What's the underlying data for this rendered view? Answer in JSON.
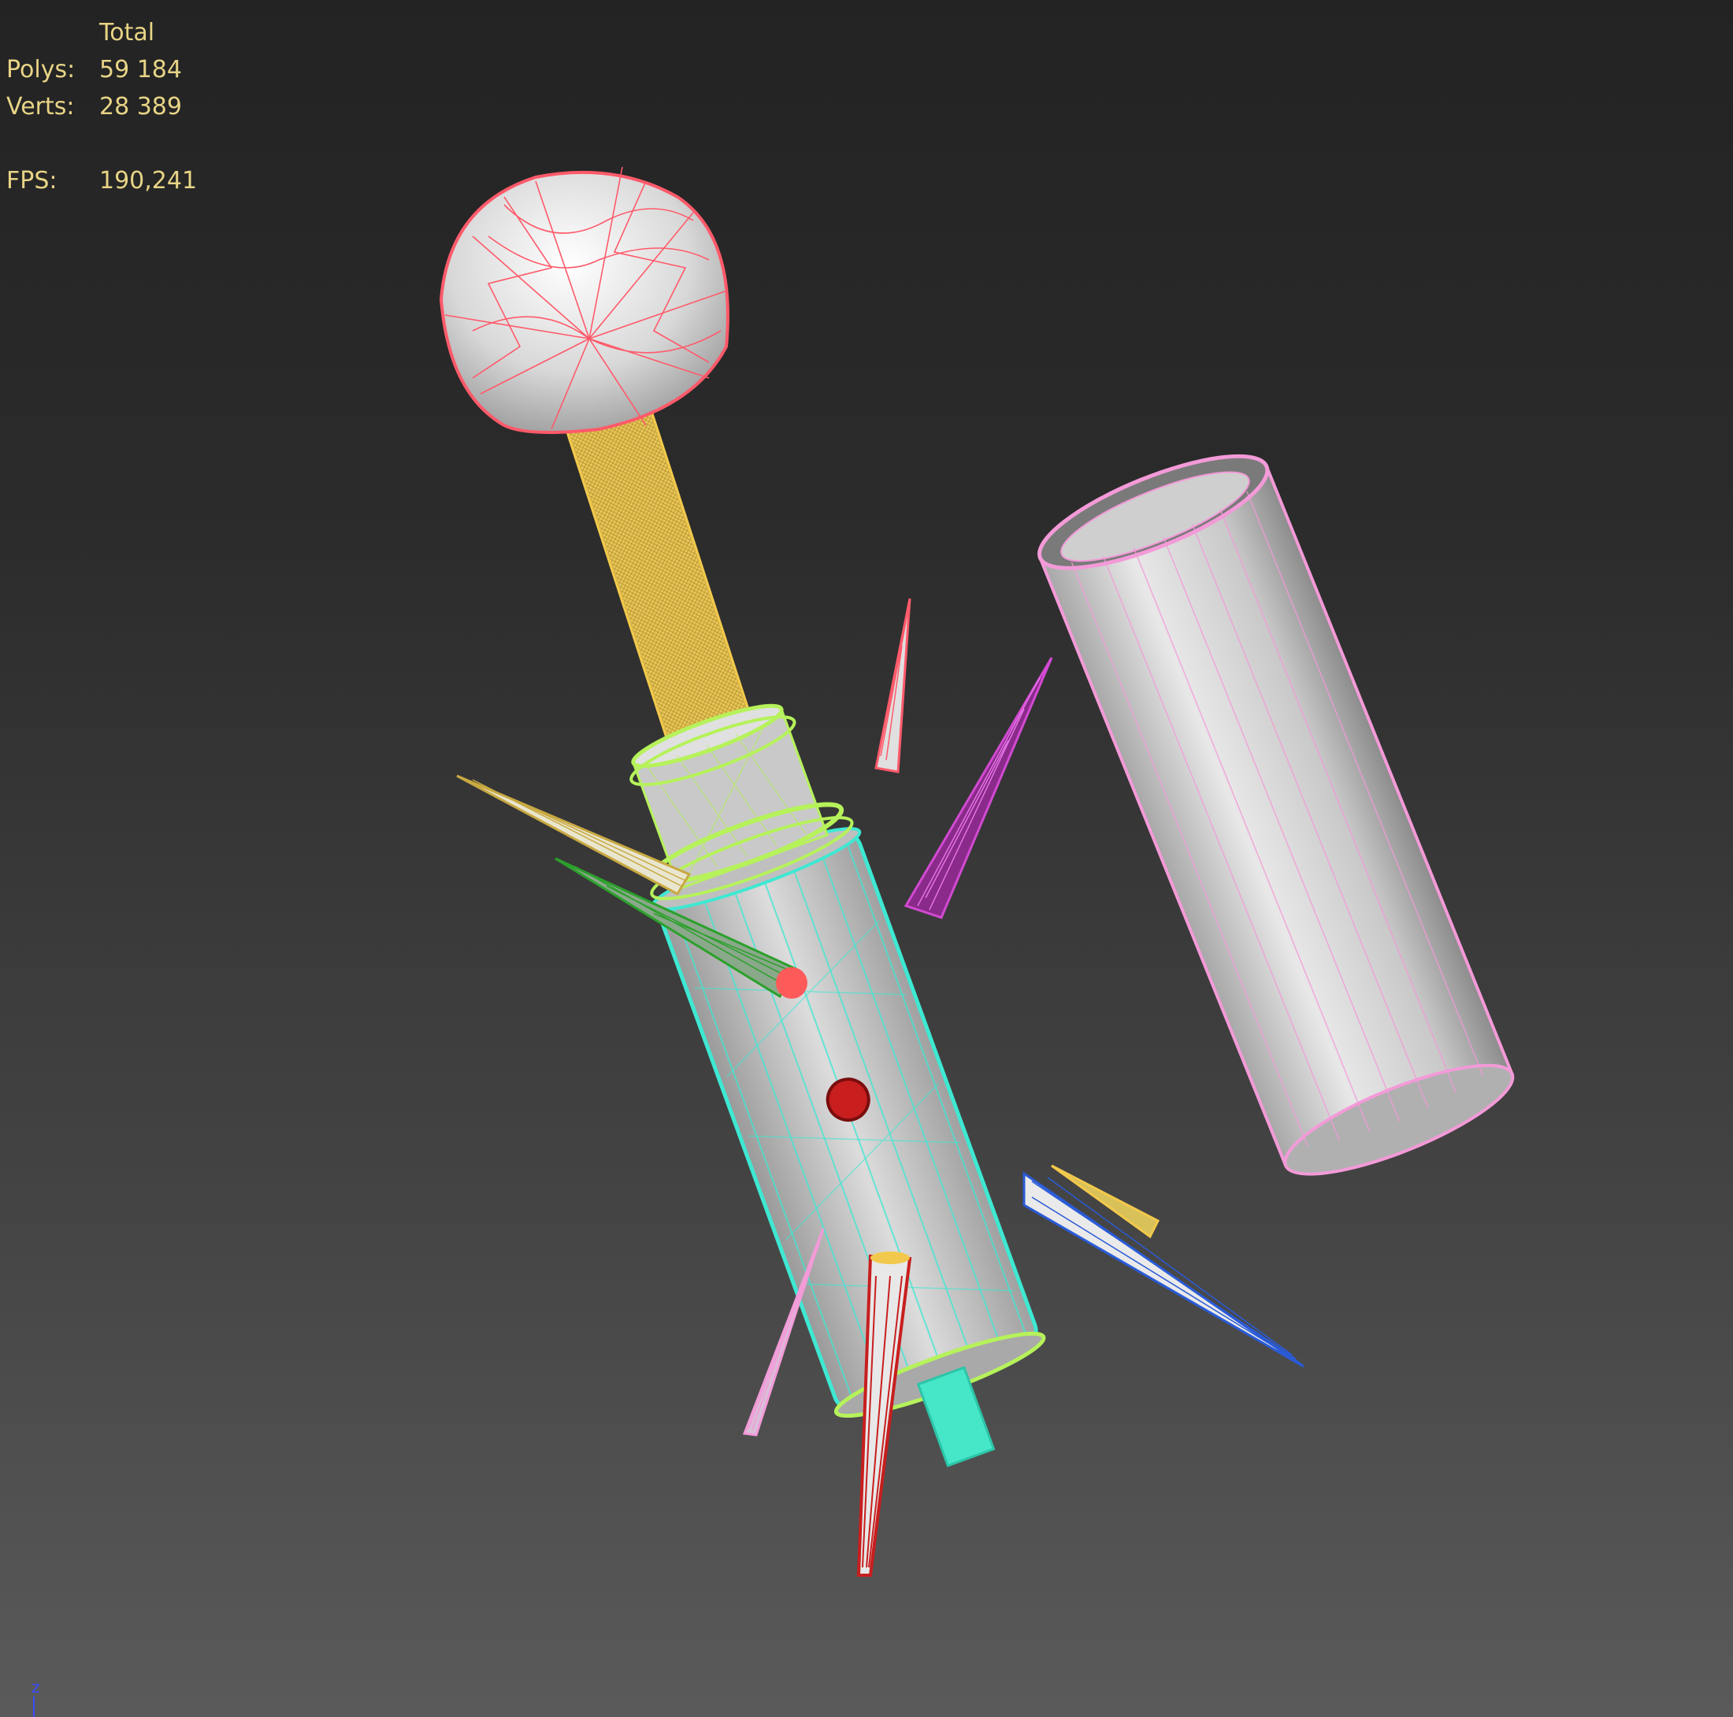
{
  "stats": {
    "heading": "Total",
    "polys_label": "Polys:",
    "polys_value": "59 184",
    "verts_label": "Verts:",
    "verts_value": "28 389",
    "fps_label": "FPS:",
    "fps_value": "190,241"
  },
  "axis_gizmo": {
    "label": "z"
  },
  "colors": {
    "stats_text": "#e8d486",
    "sphere_wire": "#ff5a6a",
    "rod_wire": "#f2c94c",
    "body_wire": "#3ee8d2",
    "collar_wire": "#b6f25a",
    "tube_wire": "#f39ad8",
    "axis": "#3a4cff"
  },
  "icons": [
    "z-axis-gizmo-icon"
  ]
}
